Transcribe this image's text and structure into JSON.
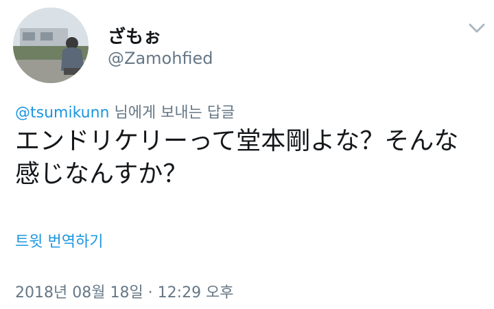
{
  "user": {
    "display_name": "ざもぉ",
    "handle": "@Zamohfied"
  },
  "header": {
    "more_icon": "chevron-down-icon"
  },
  "reply_to": {
    "mention": "@tsumikunn",
    "suffix": " 님에게 보내는 답글"
  },
  "tweet": {
    "text": "エンドリケリーって堂本剛よな？そんな感じなんすか？",
    "translate_label": "트윗 번역하기",
    "timestamp": "2018년 08월 18일 · 12:29 오후"
  },
  "colors": {
    "link": "#1b95e0",
    "secondary": "#657786",
    "primary_text": "#14171a"
  }
}
